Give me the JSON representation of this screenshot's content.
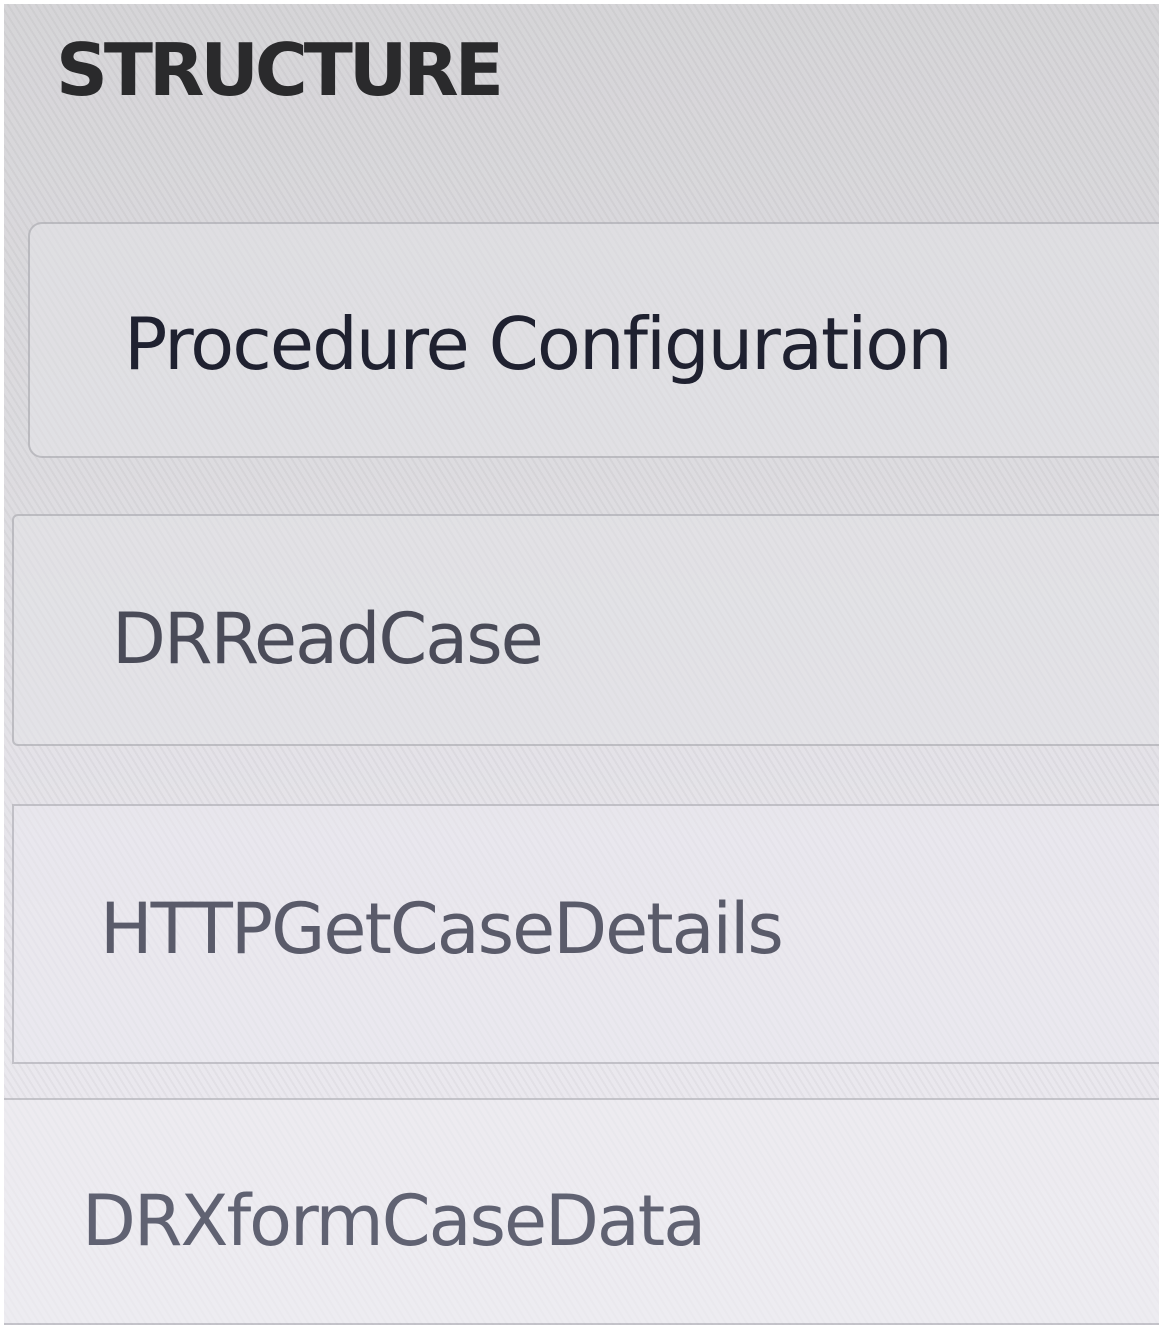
{
  "panel": {
    "title": "STRUCTURE"
  },
  "structure": {
    "items": [
      {
        "label": "Procedure Configuration"
      },
      {
        "label": "DRReadCase"
      },
      {
        "label": "HTTPGetCaseDetails"
      },
      {
        "label": "DRXformCaseData"
      }
    ]
  }
}
